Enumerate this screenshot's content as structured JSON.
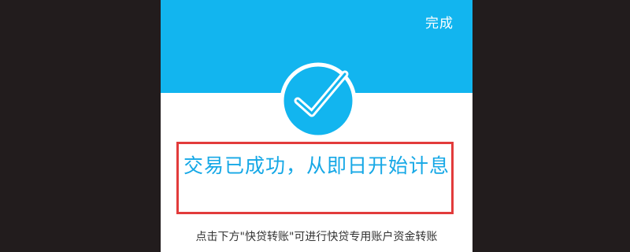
{
  "header": {
    "done_label": "完成",
    "color": "#12b5ef"
  },
  "status": {
    "icon": "check-circle-icon",
    "message": "交易已成功，从即日开始计息",
    "message_color": "#16a8e6",
    "highlight_color": "#e23b3b"
  },
  "hint": {
    "text": "点击下方\"快贷转账\"可进行快贷专用账户资金转账"
  }
}
